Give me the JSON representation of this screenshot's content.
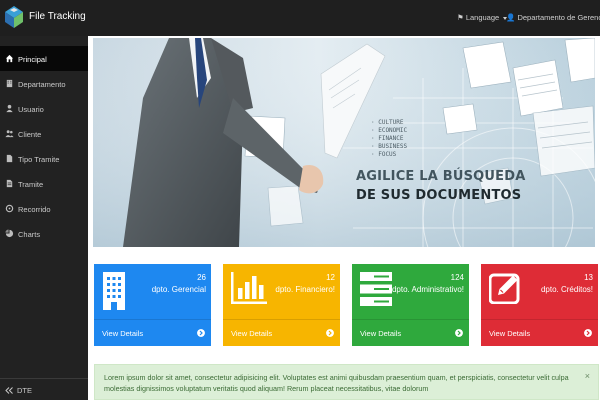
{
  "app": {
    "title": "File Tracking"
  },
  "navbar": {
    "language_label": "Language",
    "user_label": "Departamento de Gerencia"
  },
  "sidebar": {
    "items": [
      {
        "label": "Principal",
        "icon": "home-icon",
        "active": true
      },
      {
        "label": "Departamento",
        "icon": "building-icon"
      },
      {
        "label": "Usuario",
        "icon": "user-icon"
      },
      {
        "label": "Cliente",
        "icon": "users-icon"
      },
      {
        "label": "Tipo Tramite",
        "icon": "file-icon"
      },
      {
        "label": "Tramite",
        "icon": "document-icon"
      },
      {
        "label": "Recorrido",
        "icon": "route-icon"
      },
      {
        "label": "Charts",
        "icon": "chart-icon"
      }
    ],
    "footer_label": "DTE"
  },
  "banner": {
    "headline_line1": "AGILICE LA BÚSQUEDA",
    "headline_line2": "DE SUS DOCUMENTOS"
  },
  "panels": [
    {
      "count": "26",
      "label": "dpto. Gerencial",
      "link": "View Details",
      "color": "#1e88f0",
      "icon": "building-icon"
    },
    {
      "count": "12",
      "label": "dpto. Financiero!",
      "link": "View Details",
      "color": "#f7b500",
      "icon": "bar-chart-icon"
    },
    {
      "count": "124",
      "label": "dpto. Administrativo!",
      "link": "View Details",
      "color": "#2fa93d",
      "icon": "server-icon"
    },
    {
      "count": "13",
      "label": "dpto. Créditos!",
      "link": "View Details",
      "color": "#de2c36",
      "icon": "edit-icon"
    }
  ],
  "alert": {
    "text": "Lorem ipsum dolor sit amet, consectetur adipisicing elit. Voluptates est animi quibusdam praesentium quam, et perspiciatis, consectetur velit culpa molestias dignissimos voluptatum veritatis quod aliquam! Rerum placeat necessitatibus, vitae dolorum",
    "close_label": "×"
  }
}
